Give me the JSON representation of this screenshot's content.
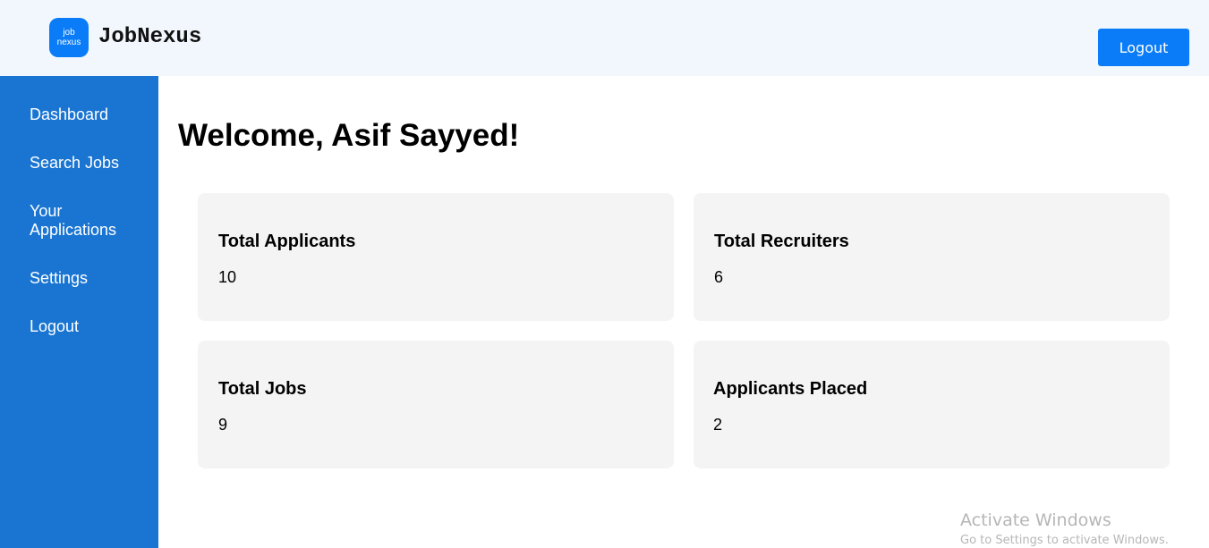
{
  "header": {
    "logo_line1": "job",
    "logo_line2": "nexus",
    "brand": "JobNexus",
    "logout_label": "Logout"
  },
  "sidebar": {
    "items": [
      {
        "label": "Dashboard"
      },
      {
        "label": "Search Jobs"
      },
      {
        "label": "Your Applications"
      },
      {
        "label": "Settings"
      },
      {
        "label": "Logout"
      }
    ]
  },
  "main": {
    "title": "Welcome, Asif Sayyed!",
    "stats": [
      {
        "label": "Total Applicants",
        "value": "10"
      },
      {
        "label": "Total Recruiters",
        "value": "6"
      },
      {
        "label": "Total Jobs",
        "value": "9"
      },
      {
        "label": "Applicants Placed",
        "value": "2"
      }
    ]
  },
  "watermark": {
    "title": "Activate Windows",
    "subtitle": "Go to Settings to activate Windows."
  },
  "colors": {
    "accent": "#0a7cf7",
    "sidebar": "#1a75d2",
    "header_bg": "#f2f7fd",
    "card_bg": "#f4f4f4"
  }
}
